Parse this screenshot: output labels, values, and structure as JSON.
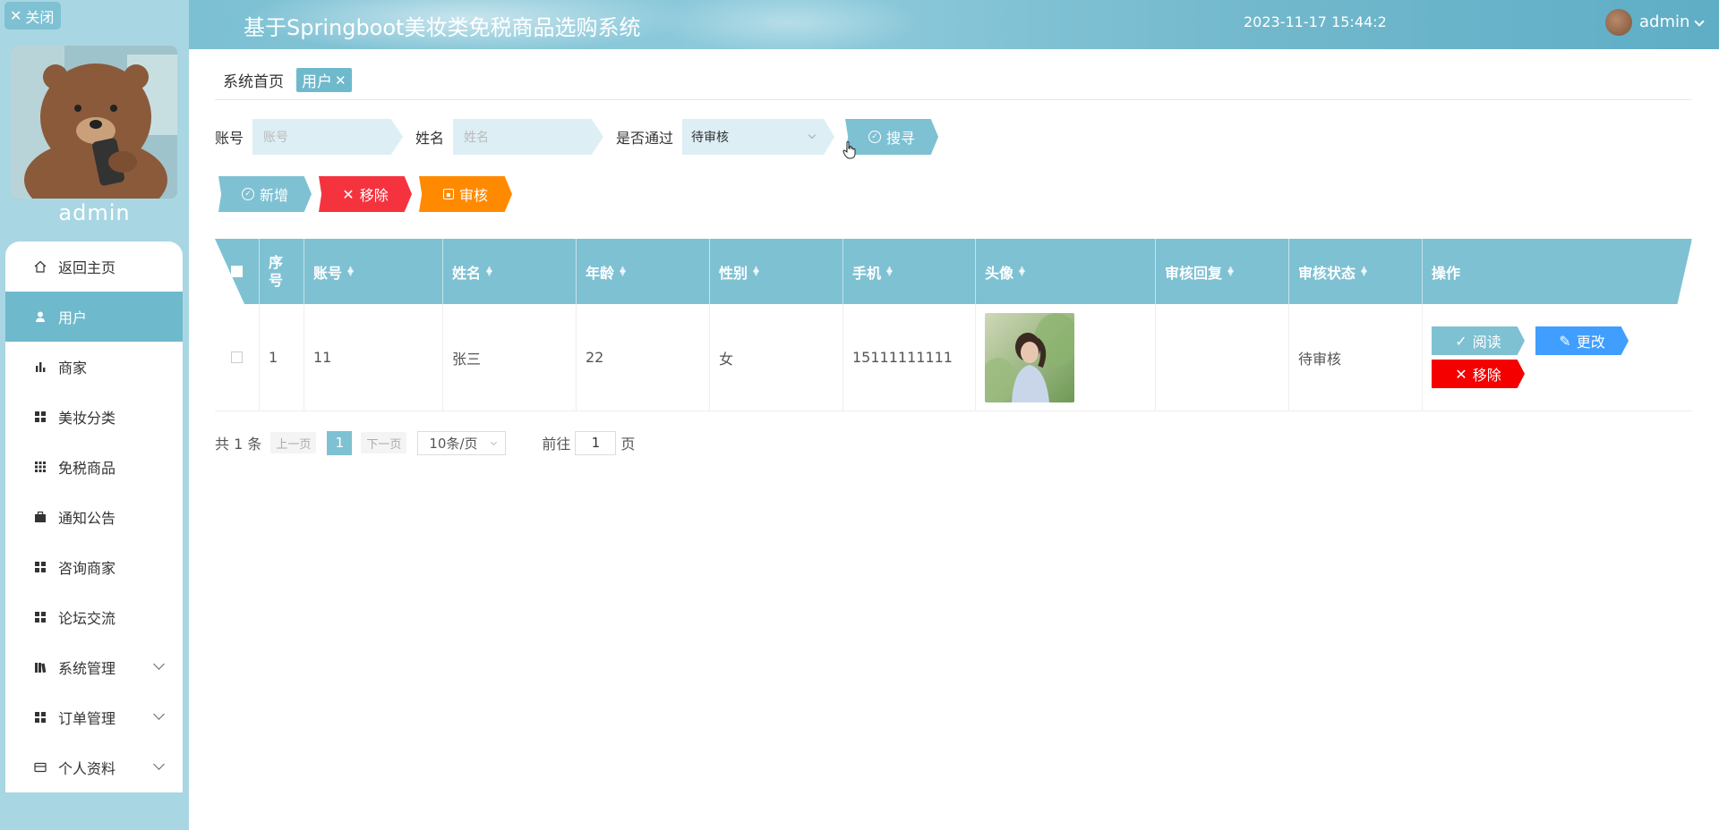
{
  "header": {
    "title": "基于Springboot美妆类免税商品选购系统",
    "datetime": "2023-11-17 15:44:2",
    "username": "admin"
  },
  "sidebar": {
    "close_label": "关闭",
    "username": "admin",
    "items": [
      {
        "label": "返回主页",
        "icon": "home-icon"
      },
      {
        "label": "用户",
        "icon": "user-icon"
      },
      {
        "label": "商家",
        "icon": "bar-chart-icon"
      },
      {
        "label": "美妆分类",
        "icon": "grid-icon"
      },
      {
        "label": "免税商品",
        "icon": "dots-grid-icon"
      },
      {
        "label": "通知公告",
        "icon": "briefcase-icon"
      },
      {
        "label": "咨询商家",
        "icon": "grid-icon"
      },
      {
        "label": "论坛交流",
        "icon": "grid-icon"
      },
      {
        "label": "系统管理",
        "icon": "book-icon"
      },
      {
        "label": "订单管理",
        "icon": "grid-icon"
      },
      {
        "label": "个人资料",
        "icon": "card-icon"
      }
    ]
  },
  "tabs": {
    "home": "系统首页",
    "current": "用户"
  },
  "search": {
    "account_label": "账号",
    "account_placeholder": "账号",
    "name_label": "姓名",
    "name_placeholder": "姓名",
    "passed_label": "是否通过",
    "passed_value": "待审核",
    "search_button": "搜寻"
  },
  "actions": {
    "add": "新增",
    "remove": "移除",
    "audit": "审核"
  },
  "table": {
    "headers": [
      "序号",
      "账号",
      "姓名",
      "年龄",
      "性别",
      "手机",
      "头像",
      "审核回复",
      "审核状态",
      "操作"
    ],
    "rows": [
      {
        "index": "1",
        "account": "11",
        "name": "张三",
        "age": "22",
        "gender": "女",
        "phone": "15111111111",
        "reply": "",
        "status": "待审核"
      }
    ],
    "row_actions": {
      "read": "阅读",
      "edit": "更改",
      "remove": "移除"
    }
  },
  "pagination": {
    "total": "共 1 条",
    "prev": "上一页",
    "current_page": "1",
    "next": "下一页",
    "page_size": "10条/页",
    "goto_label": "前往",
    "goto_value": "1",
    "page_suffix": "页"
  },
  "colors": {
    "accent": "#7ec1d3",
    "sidebar_bg": "#a9d6e3",
    "danger": "#f5333f",
    "warning": "#ff8a00",
    "primary": "#409eff"
  }
}
